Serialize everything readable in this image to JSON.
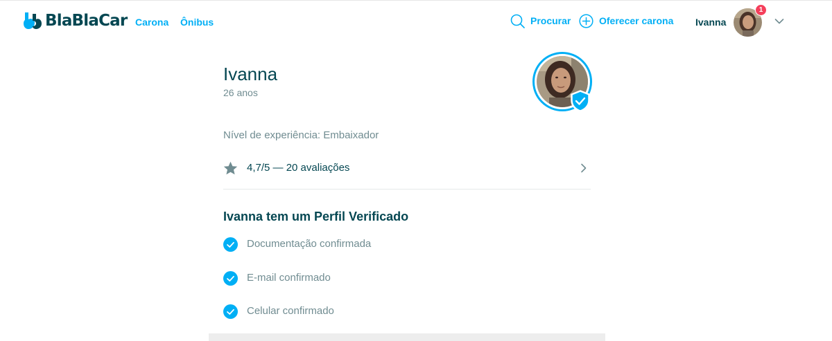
{
  "header": {
    "logo_text": "BlaBlaCar",
    "nav": {
      "carona": "Carona",
      "onibus": "Ônibus"
    },
    "search_label": "Procurar",
    "offer_label": "Oferecer carona",
    "user_name": "Ivanna",
    "notification_count": "1",
    "icons": {
      "search": "search-icon",
      "offer": "plus-circle-icon",
      "menu": "chevron-down-icon"
    }
  },
  "profile": {
    "name": "Ivanna",
    "age": "26 anos",
    "experience": "Nível de experiência: Embaixador",
    "rating": "4,7/5 — 20 avaliações",
    "verified_title": "Ivanna tem um Perfil Verificado",
    "verifications": [
      "Documentação confirmada",
      "E-mail confirmado",
      "Celular confirmado"
    ]
  },
  "colors": {
    "brand_blue": "#00aff5",
    "text_dark": "#054752",
    "text_muted": "#708c91",
    "badge_red": "#f53f5b",
    "star_gray": "#708c91"
  }
}
